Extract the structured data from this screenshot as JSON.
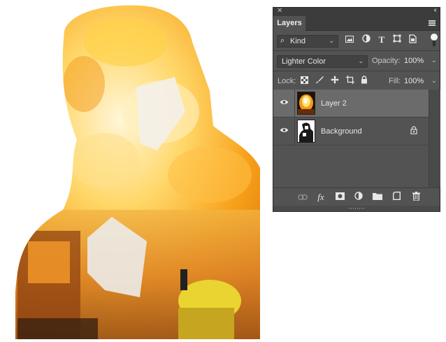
{
  "panel": {
    "title": "Layers",
    "close_glyph": "✕",
    "collapse_glyph": "‹‹",
    "menu_icon": "panel-menu-icon"
  },
  "filter": {
    "kind_label": "Kind",
    "icons": [
      "image-filter-icon",
      "adjustment-filter-icon",
      "type-filter-icon",
      "shape-filter-icon",
      "smart-object-filter-icon"
    ],
    "toggle_on": true
  },
  "blend": {
    "mode": "Lighter Color",
    "opacity_label": "Opacity:",
    "opacity_value": "100%"
  },
  "lock": {
    "label": "Lock:",
    "icons": [
      "lock-transparent-pixels-icon",
      "lock-image-pixels-icon",
      "lock-position-icon",
      "lock-artboard-icon",
      "lock-all-icon"
    ],
    "fill_label": "Fill:",
    "fill_value": "100%"
  },
  "layers": [
    {
      "name": "Layer 2",
      "visible": true,
      "selected": true,
      "locked": false,
      "thumb": "fire-thumbnail"
    },
    {
      "name": "Background",
      "visible": true,
      "selected": false,
      "locked": true,
      "thumb": "firefighter-thumbnail"
    }
  ],
  "bottom_bar": {
    "icons": [
      "link-layers-icon",
      "fx-icon",
      "add-mask-icon",
      "adjustment-layer-icon",
      "new-group-icon",
      "new-layer-icon",
      "delete-layer-icon"
    ],
    "fx_label": "fx"
  },
  "colors": {
    "panel_bg": "#535353",
    "tab_bar": "#3c3c3c",
    "selected_row": "#6b6b6b",
    "fire_orange": "#f39a1a",
    "fire_yellow": "#ffe27a"
  }
}
